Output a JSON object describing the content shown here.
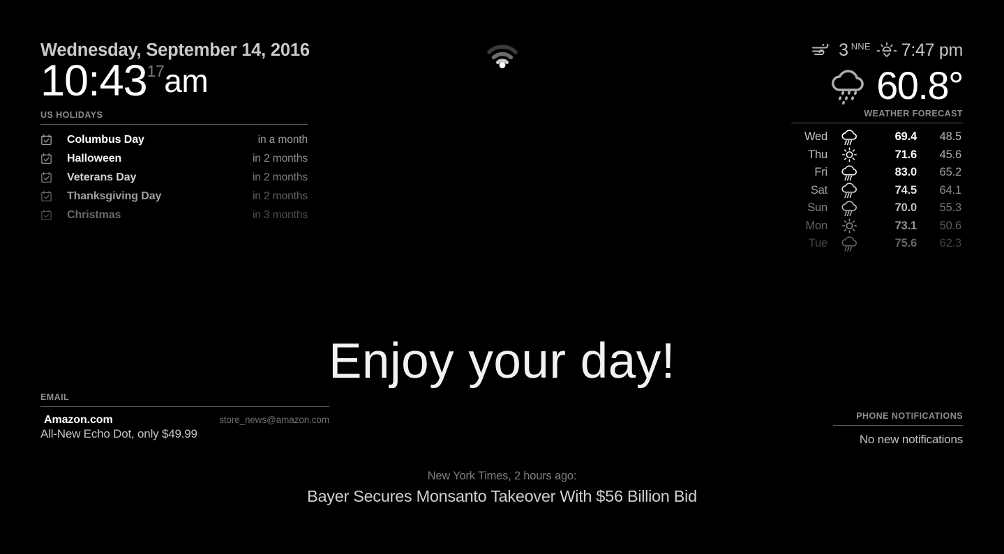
{
  "datetime": {
    "date": "Wednesday, September 14, 2016",
    "time": "10:43",
    "seconds": "17",
    "ampm": "am"
  },
  "holidays": {
    "label": "US HOLIDAYS",
    "icon": "calendar-check-icon",
    "items": [
      {
        "name": "Columbus Day",
        "when": "in a month"
      },
      {
        "name": "Halloween",
        "when": "in 2 months"
      },
      {
        "name": "Veterans Day",
        "when": "in 2 months"
      },
      {
        "name": "Thanksgiving Day",
        "when": "in 2 months"
      },
      {
        "name": "Christmas",
        "when": "in 3 months"
      }
    ]
  },
  "status": {
    "wifi_icon": "wifi-icon"
  },
  "weather": {
    "wind_icon": "wind-icon",
    "wind_speed": "3",
    "wind_direction": "NNE",
    "sunset_icon": "sunset-icon",
    "sunset_time": "7:47 pm",
    "current_icon": "rain-cloud-icon",
    "current_temp": "60.8°",
    "forecast_label": "WEATHER FORECAST",
    "forecast": [
      {
        "day": "Wed",
        "icon": "rain-icon",
        "high": "69.4",
        "low": "48.5"
      },
      {
        "day": "Thu",
        "icon": "sunny-icon",
        "high": "71.6",
        "low": "45.6"
      },
      {
        "day": "Fri",
        "icon": "rain-icon",
        "high": "83.0",
        "low": "65.2"
      },
      {
        "day": "Sat",
        "icon": "rain-icon",
        "high": "74.5",
        "low": "64.1"
      },
      {
        "day": "Sun",
        "icon": "rain-icon",
        "high": "70.0",
        "low": "55.3"
      },
      {
        "day": "Mon",
        "icon": "sunny-icon",
        "high": "73.1",
        "low": "50.6"
      },
      {
        "day": "Tue",
        "icon": "rain-icon",
        "high": "75.6",
        "low": "62.3"
      }
    ]
  },
  "greeting": {
    "text": "Enjoy your day!"
  },
  "email": {
    "label": "EMAIL",
    "items": [
      {
        "sender": "Amazon.com",
        "address": "store_news@amazon.com",
        "subject": "All-New Echo Dot, only $49.99"
      }
    ]
  },
  "notifications": {
    "label": "PHONE NOTIFICATIONS",
    "empty_text": "No new notifications"
  },
  "news": {
    "source": "New York Times, 2 hours ago:",
    "headline": "Bayer Secures Monsanto Takeover With $56 Billion Bid"
  },
  "colors": {
    "background": "#000000",
    "primary_text": "#ffffff",
    "secondary_text": "#9d9d9d",
    "divider": "#5a5a5a"
  }
}
